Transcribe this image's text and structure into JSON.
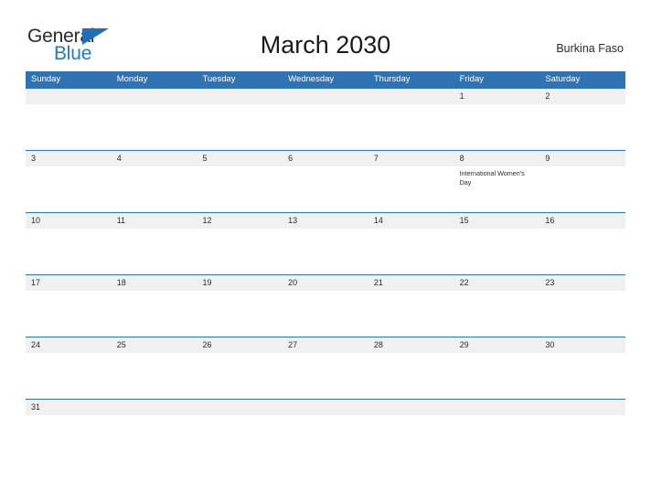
{
  "brand": {
    "name_part1": "General",
    "name_part2": "Blue",
    "triangle_color": "#1e6fb8",
    "blue_text_color": "#1e7bc4"
  },
  "header": {
    "title": "March 2030",
    "country": "Burkina Faso"
  },
  "theme": {
    "header_blue": "#2f73b3",
    "row_line_blue": "#2f73b3",
    "daynum_band_gray": "#f0f0f0",
    "page_background": "#ffffff",
    "text_color": "#2b2b2b"
  },
  "weekdays": [
    "Sunday",
    "Monday",
    "Tuesday",
    "Wednesday",
    "Thursday",
    "Friday",
    "Saturday"
  ],
  "weeks": [
    {
      "days": [
        {
          "num": "",
          "event": ""
        },
        {
          "num": "",
          "event": ""
        },
        {
          "num": "",
          "event": ""
        },
        {
          "num": "",
          "event": ""
        },
        {
          "num": "",
          "event": ""
        },
        {
          "num": "1",
          "event": ""
        },
        {
          "num": "2",
          "event": ""
        }
      ]
    },
    {
      "days": [
        {
          "num": "3",
          "event": ""
        },
        {
          "num": "4",
          "event": ""
        },
        {
          "num": "5",
          "event": ""
        },
        {
          "num": "6",
          "event": ""
        },
        {
          "num": "7",
          "event": ""
        },
        {
          "num": "8",
          "event": "International Women's Day"
        },
        {
          "num": "9",
          "event": ""
        }
      ]
    },
    {
      "days": [
        {
          "num": "10",
          "event": ""
        },
        {
          "num": "11",
          "event": ""
        },
        {
          "num": "12",
          "event": ""
        },
        {
          "num": "13",
          "event": ""
        },
        {
          "num": "14",
          "event": ""
        },
        {
          "num": "15",
          "event": ""
        },
        {
          "num": "16",
          "event": ""
        }
      ]
    },
    {
      "days": [
        {
          "num": "17",
          "event": ""
        },
        {
          "num": "18",
          "event": ""
        },
        {
          "num": "19",
          "event": ""
        },
        {
          "num": "20",
          "event": ""
        },
        {
          "num": "21",
          "event": ""
        },
        {
          "num": "22",
          "event": ""
        },
        {
          "num": "23",
          "event": ""
        }
      ]
    },
    {
      "days": [
        {
          "num": "24",
          "event": ""
        },
        {
          "num": "25",
          "event": ""
        },
        {
          "num": "26",
          "event": ""
        },
        {
          "num": "27",
          "event": ""
        },
        {
          "num": "28",
          "event": ""
        },
        {
          "num": "29",
          "event": ""
        },
        {
          "num": "30",
          "event": ""
        }
      ]
    },
    {
      "days": [
        {
          "num": "31",
          "event": ""
        },
        {
          "num": "",
          "event": ""
        },
        {
          "num": "",
          "event": ""
        },
        {
          "num": "",
          "event": ""
        },
        {
          "num": "",
          "event": ""
        },
        {
          "num": "",
          "event": ""
        },
        {
          "num": "",
          "event": ""
        }
      ]
    }
  ]
}
